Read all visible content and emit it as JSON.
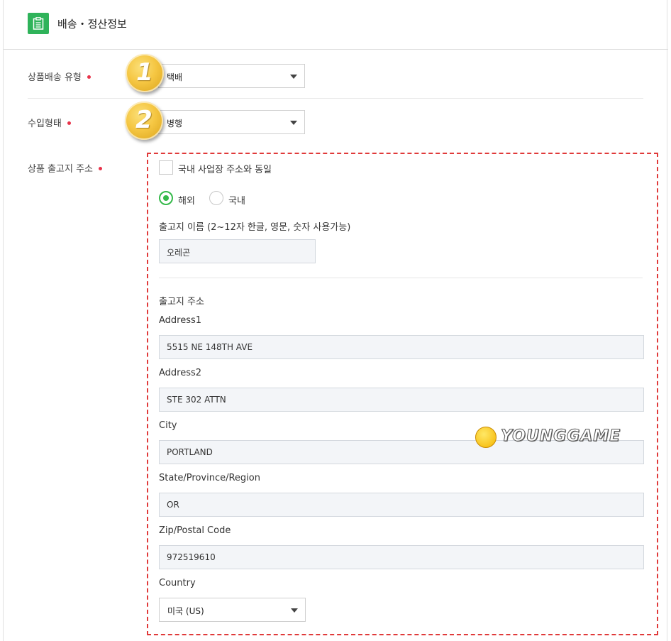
{
  "header": {
    "title": "배송・정산정보",
    "icon": "clipboard-icon"
  },
  "fields": {
    "delivery_type": {
      "label": "상품배송 유형",
      "value": "택배"
    },
    "import_type": {
      "label": "수입형태",
      "value": "병행"
    },
    "warehouse_address": {
      "label": "상품 출고지 주소"
    }
  },
  "badges": [
    "1",
    "2"
  ],
  "warehouse": {
    "same_as_domestic_label": "국내 사업장 주소와 동일",
    "radio_overseas": "해외",
    "radio_domestic": "국내",
    "name_label": "출고지 이름 (2~12자 한글, 영문, 숫자 사용가능)",
    "name_value": "오레곤",
    "address_section_label": "출고지 주소",
    "address1_label": "Address1",
    "address1_value": "5515 NE 148TH AVE",
    "address2_label": "Address2",
    "address2_value": "STE 302 ATTN",
    "city_label": "City",
    "city_value": "PORTLAND",
    "state_label": "State/Province/Region",
    "state_value": "OR",
    "zip_label": "Zip/Postal Code",
    "zip_value": "972519610",
    "country_label": "Country",
    "country_value": "미국 (US)"
  },
  "watermark": {
    "text": "YOUNGGAME"
  },
  "colors": {
    "brand_green": "#2fb35a",
    "required_dot": "#e8334a",
    "radio_green": "#35b94a",
    "highlight_border": "#e03a3a"
  }
}
